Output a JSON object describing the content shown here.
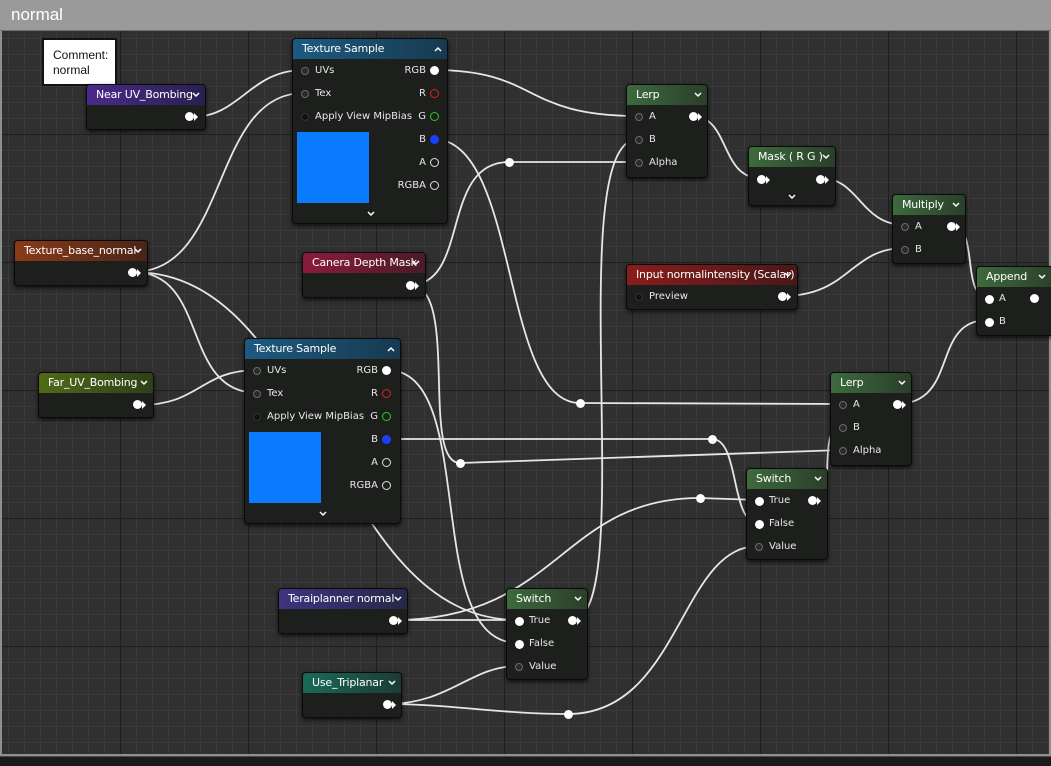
{
  "comment": {
    "title": "normal",
    "box_text_line1": "Comment:",
    "box_text_line2": "normal"
  },
  "nodes": {
    "near_uv": {
      "title": "Near UV_Bombing",
      "color": "#4a2a8a"
    },
    "tex_sample_1": {
      "title": "Texture Sample",
      "color": "#1d5a80",
      "inputs": [
        "UVs",
        "Tex",
        "Apply View MipBias"
      ],
      "outputs": [
        "RGB",
        "R",
        "G",
        "B",
        "A",
        "RGBA"
      ]
    },
    "tex_base_normal": {
      "title": "Texture_base_normal",
      "color": "#8a3a18"
    },
    "far_uv": {
      "title": "Far_UV_Bombing",
      "color": "#4e6a18"
    },
    "tex_sample_2": {
      "title": "Texture Sample",
      "color": "#1d5a80",
      "inputs": [
        "UVs",
        "Tex",
        "Apply View MipBias"
      ],
      "outputs": [
        "RGB",
        "R",
        "G",
        "B",
        "A",
        "RGBA"
      ]
    },
    "camera_depth": {
      "title": "Canera Depth Mask",
      "color": "#8a1c3c"
    },
    "lerp_1": {
      "title": "Lerp",
      "color": "#3d6a3d",
      "inputs": [
        "A",
        "B",
        "Alpha"
      ]
    },
    "mask_rg": {
      "title": "Mask ( R G )",
      "color": "#3d6a3d"
    },
    "multiply": {
      "title": "Multiply",
      "color": "#3d6a3d",
      "inputs": [
        "A",
        "B"
      ]
    },
    "input_normal": {
      "title": "Input normalintensity (Scalar)",
      "color": "#8a1c1c",
      "preview": "Preview"
    },
    "append": {
      "title": "Append",
      "color": "#3d6a3d",
      "inputs": [
        "A",
        "B"
      ]
    },
    "lerp_2": {
      "title": "Lerp",
      "color": "#3d6a3d",
      "inputs": [
        "A",
        "B",
        "Alpha"
      ]
    },
    "switch_1": {
      "title": "Switch",
      "color": "#3d6a3d",
      "inputs": [
        "True",
        "False",
        "Value"
      ]
    },
    "teraiplanner": {
      "title": "Teraiplanner normal",
      "color": "#3e3480"
    },
    "switch_2": {
      "title": "Switch",
      "color": "#3d6a3d",
      "inputs": [
        "True",
        "False",
        "Value"
      ]
    },
    "use_triplanar": {
      "title": "Use_Triplanar",
      "color": "#1a6a58"
    }
  },
  "colors": {
    "preview_blue": "#0a7bff",
    "pin_red": "#e02020",
    "pin_green": "#20d020",
    "pin_blue": "#1a40ff",
    "wire": "#e6e6e6"
  }
}
